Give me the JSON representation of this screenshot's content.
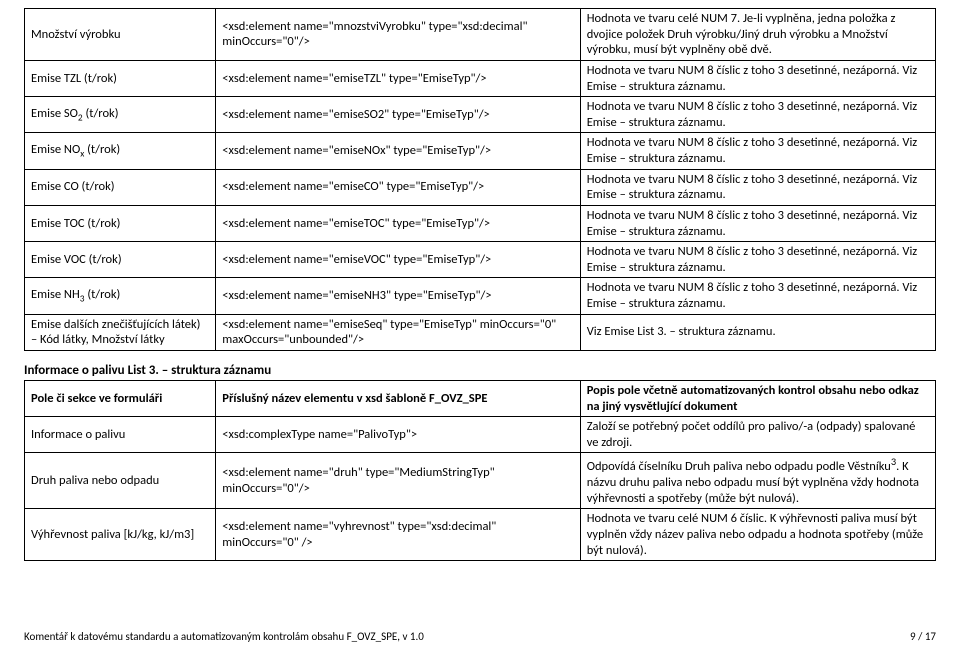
{
  "table1": {
    "rows": [
      {
        "a": "Množství výrobku",
        "b": "<xsd:element name=\"mnozstviVyrobku\" type=\"xsd:decimal\" minOccurs=\"0\"/>",
        "c": "Hodnota ve tvaru celé NUM 7. Je-li vyplněna, jedna položka z dvojice položek Druh výrobku/Jiný druh výrobku a Množství výrobku, musí být vyplněny obě dvě."
      },
      {
        "a": "Emise TZL (t/rok)",
        "b": "<xsd:element name=\"emiseTZL\" type=\"EmiseTyp\"/>",
        "c": "Hodnota ve tvaru NUM 8 číslic z toho 3 desetinné, nezáporná. Viz Emise – struktura záznamu."
      },
      {
        "a_html": "Emise SO<sub>2</sub> (t/rok)",
        "b": "<xsd:element name=\"emiseSO2\" type=\"EmiseTyp\"/>",
        "c": "Hodnota ve tvaru NUM 8 číslic z toho 3 desetinné, nezáporná. Viz Emise – struktura záznamu."
      },
      {
        "a_html": "Emise NO<sub>x</sub> (t/rok)",
        "b": "<xsd:element name=\"emiseNOx\" type=\"EmiseTyp\"/>",
        "c": "Hodnota ve tvaru NUM 8 číslic z toho 3 desetinné, nezáporná. Viz Emise – struktura záznamu."
      },
      {
        "a": "Emise CO (t/rok)",
        "b": "<xsd:element name=\"emiseCO\" type=\"EmiseTyp\"/>",
        "c": "Hodnota ve tvaru NUM 8 číslic z toho 3 desetinné, nezáporná. Viz Emise – struktura záznamu."
      },
      {
        "a": "Emise TOC (t/rok)",
        "b": "<xsd:element name=\"emiseTOC\" type=\"EmiseTyp\"/>",
        "c": "Hodnota ve tvaru NUM 8 číslic z toho 3 desetinné, nezáporná. Viz Emise – struktura záznamu."
      },
      {
        "a": "Emise VOC (t/rok)",
        "b": "<xsd:element name=\"emiseVOC\" type=\"EmiseTyp\"/>",
        "c": "Hodnota ve tvaru NUM 8 číslic z toho 3 desetinné, nezáporná. Viz Emise – struktura záznamu."
      },
      {
        "a_html": "Emise NH<sub>3</sub> (t/rok)",
        "b": "<xsd:element name=\"emiseNH3\" type=\"EmiseTyp\"/>",
        "c": "Hodnota ve tvaru NUM 8 číslic z toho 3 desetinné, nezáporná. Viz Emise – struktura záznamu."
      },
      {
        "a": "Emise dalších znečišťujících látek) – Kód látky, Množství  látky",
        "b": "<xsd:element name=\"emiseSeq\" type=\"EmiseTyp\" minOccurs=\"0\" maxOccurs=\"unbounded\"/>",
        "c": "Viz Emise List 3. – struktura záznamu."
      }
    ]
  },
  "section2": {
    "heading": "Informace o palivu List 3. – struktura záznamu",
    "header": {
      "a": "Pole či sekce ve formuláři",
      "b": "Příslušný název elementu v xsd šabloně F_OVZ_SPE",
      "c": "Popis pole včetně automatizovaných kontrol obsahu nebo odkaz na jiný vysvětlující dokument"
    },
    "rows": [
      {
        "a": "Informace o palivu",
        "b": "<xsd:complexType name=\"PalivoTyp\">",
        "c": "Založí se potřebný počet oddílů pro palivo/-a (odpady) spalované ve zdroji."
      },
      {
        "a": "Druh paliva nebo odpadu",
        "b": "<xsd:element name=\"druh\" type=\"MediumStringTyp\" minOccurs=\"0\"/>",
        "c_html": "Odpovídá číselníku Druh paliva nebo odpadu podle Věstníku<sup>3</sup>. K názvu druhu paliva nebo odpadu musí být vyplněna vždy hodnota výhřevnosti a spotřeby (může být nulová)."
      },
      {
        "a": "Výhřevnost paliva [kJ/kg, kJ/m3]",
        "b": "<xsd:element name=\"vyhrevnost\" type=\"xsd:decimal\" minOccurs=\"0\" />",
        "c": "Hodnota ve tvaru celé NUM 6 číslic. K výhřevnosti paliva musí být vyplněn vždy název paliva nebo odpadu a hodnota spotřeby (může být nulová)."
      }
    ]
  },
  "footer": {
    "left": "Komentář k datovému standardu a automatizovaným kontrolám obsahu  F_OVZ_SPE, v 1.0",
    "right": "9 / 17"
  }
}
